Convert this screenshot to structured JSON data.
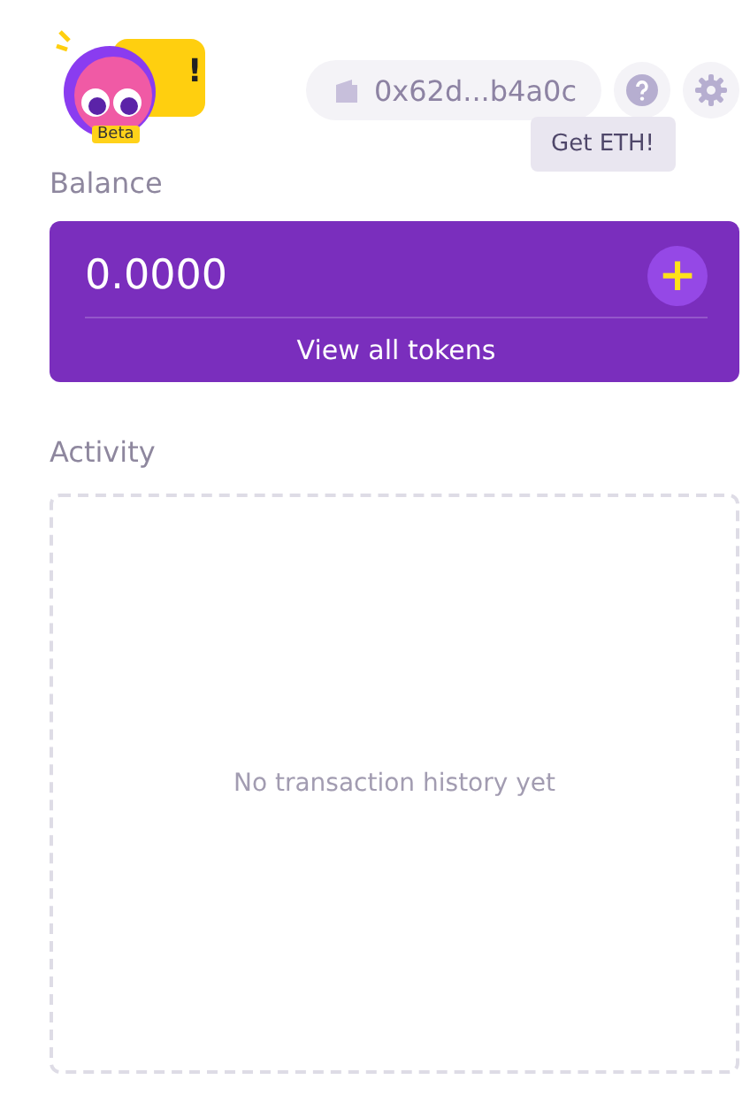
{
  "logo": {
    "alert": "!",
    "badge": "Beta"
  },
  "header": {
    "address": "0x62d...b4a0c"
  },
  "balance": {
    "label": "Balance",
    "amount": "0.0000",
    "tooltip": "Get ETH!",
    "plus": "+",
    "link": "View all tokens"
  },
  "activity": {
    "label": "Activity",
    "empty": "No transaction history yet"
  }
}
